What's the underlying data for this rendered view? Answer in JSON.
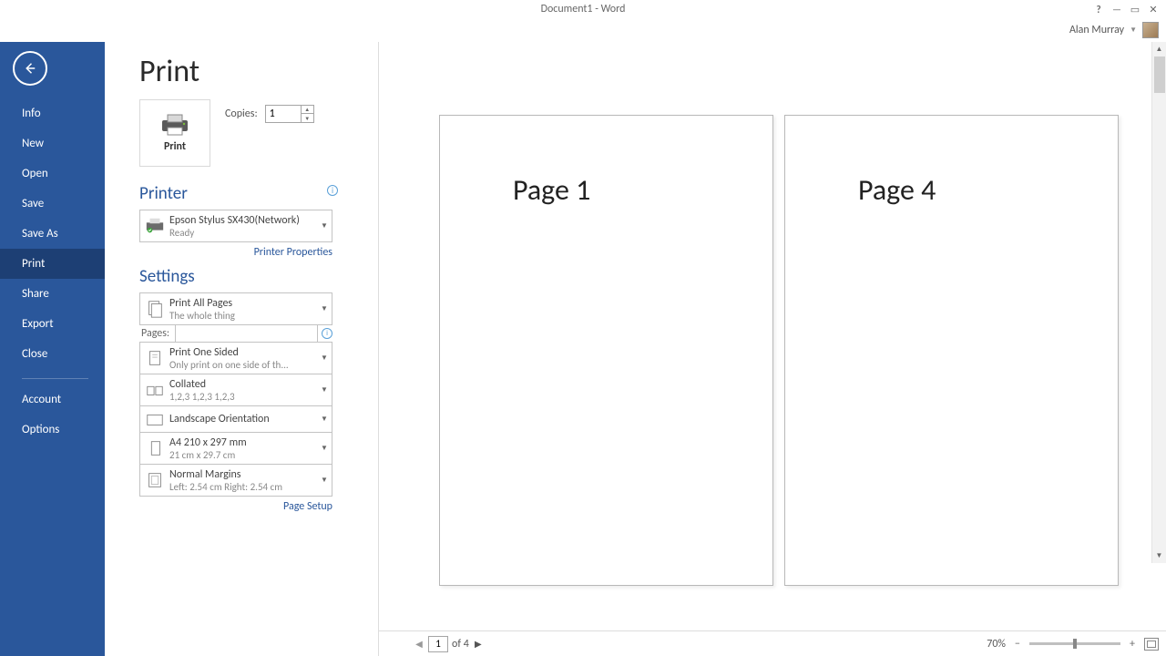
{
  "titlebar": {
    "document": "Document1 - Word"
  },
  "user": {
    "name": "Alan Murray"
  },
  "sidebar": {
    "items": [
      "Info",
      "New",
      "Open",
      "Save",
      "Save As",
      "Print",
      "Share",
      "Export",
      "Close"
    ],
    "bottom": [
      "Account",
      "Options"
    ],
    "active": "Print"
  },
  "page_title": "Print",
  "print_button": "Print",
  "copies": {
    "label": "Copies:",
    "value": "1"
  },
  "printer": {
    "heading": "Printer",
    "name": "Epson Stylus SX430(Network)",
    "status": "Ready",
    "properties_link": "Printer Properties"
  },
  "settings": {
    "heading": "Settings",
    "pages_label": "Pages:",
    "items": [
      {
        "title": "Print All Pages",
        "sub": "The whole thing"
      },
      {
        "title": "Print One Sided",
        "sub": "Only print on one side of th..."
      },
      {
        "title": "Collated",
        "sub": "1,2,3    1,2,3    1,2,3"
      },
      {
        "title": "Landscape Orientation",
        "sub": ""
      },
      {
        "title": "A4 210 x 297 mm",
        "sub": "21 cm x 29.7 cm"
      },
      {
        "title": "Normal Margins",
        "sub": "Left:  2.54 cm    Right:  2.54 cm"
      }
    ],
    "page_setup_link": "Page Setup"
  },
  "preview": {
    "page_left": "Page 1",
    "page_right": "Page 4"
  },
  "status": {
    "current_page": "1",
    "page_count": "of 4",
    "zoom": "70%"
  }
}
